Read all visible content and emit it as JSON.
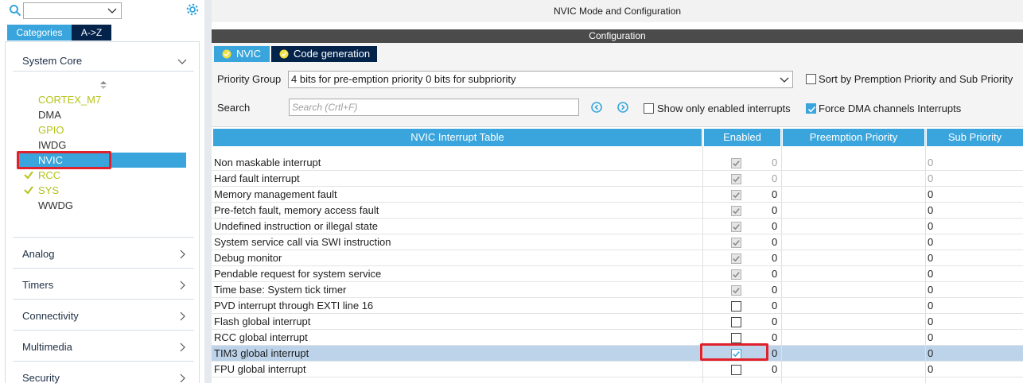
{
  "left": {
    "tabs": [
      "Categories",
      "A->Z"
    ],
    "categories": [
      {
        "label": "System Core",
        "expanded": true
      },
      {
        "label": "Analog",
        "expanded": false
      },
      {
        "label": "Timers",
        "expanded": false
      },
      {
        "label": "Connectivity",
        "expanded": false
      },
      {
        "label": "Multimedia",
        "expanded": false
      },
      {
        "label": "Security",
        "expanded": false
      }
    ],
    "peripherals": [
      {
        "label": "CORTEX_M7",
        "status": "warning"
      },
      {
        "label": "DMA",
        "status": "none"
      },
      {
        "label": "GPIO",
        "status": "warning"
      },
      {
        "label": "IWDG",
        "status": "none"
      },
      {
        "label": "NVIC",
        "status": "selected"
      },
      {
        "label": "RCC",
        "status": "ok"
      },
      {
        "label": "SYS",
        "status": "ok"
      },
      {
        "label": "WWDG",
        "status": "none"
      }
    ]
  },
  "right": {
    "title": "NVIC Mode and Configuration",
    "configuration_label": "Configuration",
    "tabs": [
      "NVIC",
      "Code generation"
    ],
    "priority_group_label": "Priority Group",
    "priority_group_value": "4 bits for pre-emption priority 0 bits for subpriority",
    "sort_label": "Sort by Premption Priority and Sub Priority",
    "search_label": "Search",
    "search_placeholder": "Search (Crtl+F)",
    "show_enabled_label": "Show only enabled interrupts",
    "force_dma_label": "Force DMA channels Interrupts",
    "sort_checked": false,
    "show_enabled_checked": false,
    "force_dma_checked": true
  },
  "table": {
    "headers": [
      "NVIC Interrupt Table",
      "Enabled",
      "Preemption Priority",
      "Sub Priority"
    ],
    "rows": [
      {
        "name": "Non maskable interrupt",
        "enabled": true,
        "locked": true,
        "pre": "0",
        "sub": "0",
        "grey": true
      },
      {
        "name": "Hard fault interrupt",
        "enabled": true,
        "locked": true,
        "pre": "0",
        "sub": "0",
        "grey": true
      },
      {
        "name": "Memory management fault",
        "enabled": true,
        "locked": true,
        "pre": "0",
        "sub": "0",
        "grey": false
      },
      {
        "name": "Pre-fetch fault, memory access fault",
        "enabled": true,
        "locked": true,
        "pre": "0",
        "sub": "0",
        "grey": false
      },
      {
        "name": "Undefined instruction or illegal state",
        "enabled": true,
        "locked": true,
        "pre": "0",
        "sub": "0",
        "grey": false
      },
      {
        "name": "System service call via SWI instruction",
        "enabled": true,
        "locked": true,
        "pre": "0",
        "sub": "0",
        "grey": false
      },
      {
        "name": "Debug monitor",
        "enabled": true,
        "locked": true,
        "pre": "0",
        "sub": "0",
        "grey": false
      },
      {
        "name": "Pendable request for system service",
        "enabled": true,
        "locked": true,
        "pre": "0",
        "sub": "0",
        "grey": false
      },
      {
        "name": "Time base: System tick timer",
        "enabled": true,
        "locked": true,
        "pre": "0",
        "sub": "0",
        "grey": false
      },
      {
        "name": "PVD interrupt through EXTI line 16",
        "enabled": false,
        "locked": false,
        "pre": "0",
        "sub": "0",
        "grey": false
      },
      {
        "name": "Flash global interrupt",
        "enabled": false,
        "locked": false,
        "pre": "0",
        "sub": "0",
        "grey": false
      },
      {
        "name": "RCC global interrupt",
        "enabled": false,
        "locked": false,
        "pre": "0",
        "sub": "0",
        "grey": false
      },
      {
        "name": "TIM3 global interrupt",
        "enabled": true,
        "locked": false,
        "pre": "0",
        "sub": "0",
        "grey": false,
        "selected": true
      },
      {
        "name": "FPU global interrupt",
        "enabled": false,
        "locked": false,
        "pre": "0",
        "sub": "0",
        "grey": false
      }
    ]
  },
  "colors": {
    "accent": "#39a5dc",
    "navy": "#03234b",
    "highlight": "#e0202a",
    "warn": "#b5c21a"
  }
}
